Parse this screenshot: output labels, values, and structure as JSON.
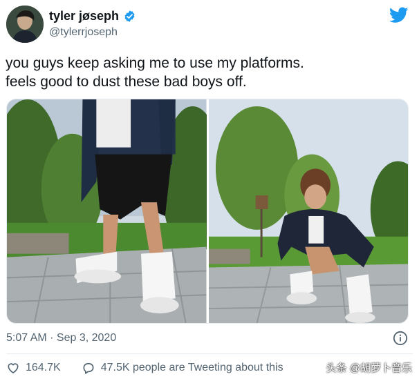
{
  "author": {
    "display_name": "tyler jøseph",
    "handle": "@tylerrjoseph",
    "verified_color": "#1d9bf0"
  },
  "tweet": {
    "lines": [
      "you guys keep asking me to use my platforms.",
      "feels good to dust these bad boys off."
    ],
    "timestamp": "5:07 AM · Sep 3, 2020"
  },
  "actions": {
    "likes": "164.7K",
    "tweeting": "47.5K people are Tweeting about this"
  },
  "watermark": "头条 @胡萝卜音乐",
  "icons": {
    "brand": "twitter-bird-icon",
    "like": "heart-icon",
    "reply": "speech-bubble-icon",
    "info": "info-icon"
  },
  "colors": {
    "brand_blue": "#1d9bf0",
    "text_secondary": "#536471"
  }
}
